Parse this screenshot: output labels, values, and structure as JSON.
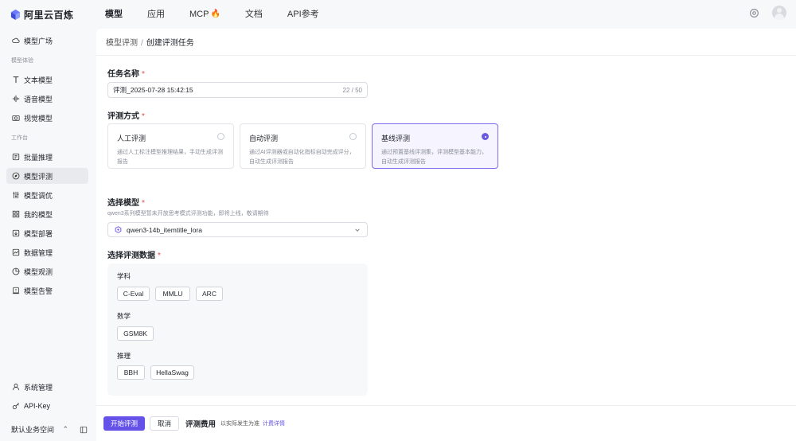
{
  "brand": {
    "name": "阿里云百炼"
  },
  "nav": {
    "items": [
      {
        "label": "模型",
        "active": true
      },
      {
        "label": "应用"
      },
      {
        "label": "MCP",
        "badge": "🔥"
      },
      {
        "label": "文档"
      },
      {
        "label": "API参考"
      }
    ]
  },
  "sidebar": {
    "square": "模型广场",
    "group_experience": "模型体验",
    "text_model": "文本模型",
    "voice_model": "语音模型",
    "vision_model": "视觉模型",
    "group_workbench": "工作台",
    "batch_infer": "批量推理",
    "model_eval": "模型评测",
    "model_tune": "模型调优",
    "my_models": "我的模型",
    "model_deploy": "模型部署",
    "data_manage": "数据管理",
    "model_observe": "模型观测",
    "model_alert": "模型告警",
    "sys_manage": "系统管理",
    "api_key": "API-Key",
    "workspace": "默认业务空间"
  },
  "breadcrumb": {
    "parent": "模型评测",
    "separator": "/",
    "current": "创建评测任务"
  },
  "form": {
    "task_name_label": "任务名称",
    "task_name_value": "评测_2025-07-28 15:42:15",
    "task_name_count": "22 / 50",
    "method_label": "评测方式",
    "methods": [
      {
        "title": "人工评测",
        "desc": "通过人工标注模型推理结果，手动生成评测报告",
        "selected": false
      },
      {
        "title": "自动评测",
        "desc": "通过AI评测器或自动化指标自动完成评分，自动生成评测报告",
        "selected": false
      },
      {
        "title": "基线评测",
        "desc": "通过预置基线评测集，评测模型基本能力，自动生成评测报告",
        "selected": true
      }
    ],
    "model_label": "选择模型",
    "model_hint": "qwen3系列模型暂未开放思考模式评测功能，即将上线，敬请期待",
    "model_value": "qwen3-14b_itemtitle_lora",
    "dataset_label": "选择评测数据",
    "datasets": {
      "subject_label": "学科",
      "subject_items": [
        "C-Eval",
        "MMLU",
        "ARC"
      ],
      "math_label": "数学",
      "math_items": [
        "GSM8K"
      ],
      "reasoning_label": "推理",
      "reasoning_items": [
        "BBH",
        "HellaSwag"
      ]
    },
    "required_mark": "*"
  },
  "actions": {
    "start": "开始评测",
    "cancel": "取消",
    "cost_label": "评测费用",
    "cost_hint": "以实际发生为准",
    "cost_link": "计费详情"
  },
  "colors": {
    "accent": "#6552e8",
    "selected_border": "#7c6cf0",
    "required": "#e04848"
  }
}
